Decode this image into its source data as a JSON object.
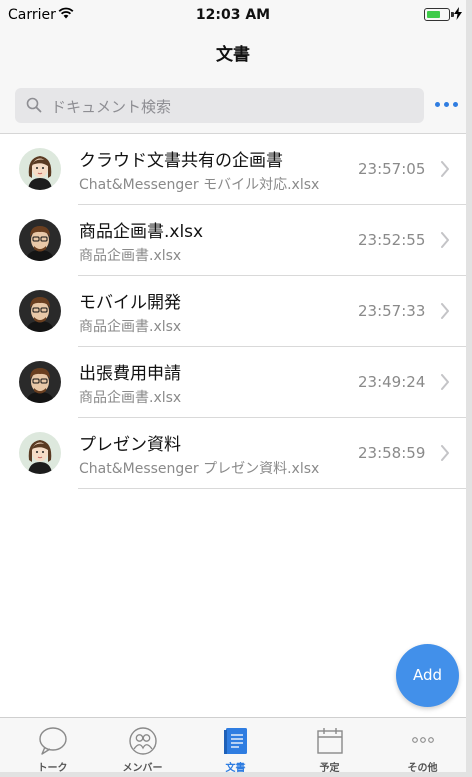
{
  "status_bar": {
    "carrier": "Carrier",
    "time": "12:03 AM"
  },
  "header": {
    "title": "文書"
  },
  "search": {
    "placeholder": "ドキュメント検索"
  },
  "documents": [
    {
      "title": "クラウド文書共有の企画書",
      "subtitle": "Chat&Messenger モバイル対応.xlsx",
      "time": "23:57:05",
      "avatar": "female-avatar"
    },
    {
      "title": "商品企画書.xlsx",
      "subtitle": "商品企画書.xlsx",
      "time": "23:52:55",
      "avatar": "male-avatar"
    },
    {
      "title": "モバイル開発",
      "subtitle": "商品企画書.xlsx",
      "time": "23:57:33",
      "avatar": "male-avatar"
    },
    {
      "title": "出張費用申請",
      "subtitle": "商品企画書.xlsx",
      "time": "23:49:24",
      "avatar": "male-avatar"
    },
    {
      "title": "プレゼン資料",
      "subtitle": "Chat&Messenger プレゼン資料.xlsx",
      "time": "23:58:59",
      "avatar": "female-avatar"
    }
  ],
  "fab": {
    "label": "Add"
  },
  "tabs": [
    {
      "label": "トーク",
      "icon": "chat-bubble-icon"
    },
    {
      "label": "メンバー",
      "icon": "members-icon"
    },
    {
      "label": "文書",
      "icon": "document-icon",
      "active": true
    },
    {
      "label": "予定",
      "icon": "calendar-icon"
    },
    {
      "label": "その他",
      "icon": "more-icon"
    }
  ],
  "colors": {
    "accent": "#2f7de1",
    "fab": "#4290ea",
    "battery": "#3fcb4a"
  }
}
